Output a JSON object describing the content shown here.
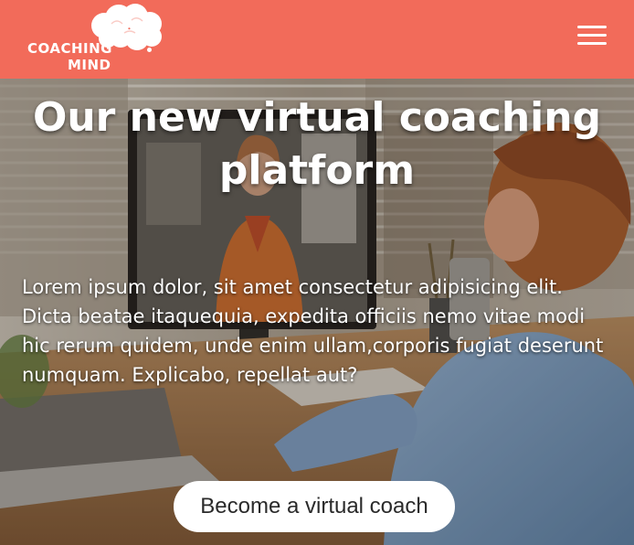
{
  "header": {
    "logo_line1": "COACHING",
    "logo_line2": "MIND",
    "background_color": "#f26b5a",
    "menu_icon": "hamburger-menu-icon"
  },
  "hero": {
    "title": "Our new virtual coaching platform",
    "body": "Lorem ipsum dolor, sit amet consectetur adipisicing elit. Dicta beatae itaquequia, expedita officiis nemo vitae modi hic rerum quidem, unde enim ullam,corporis fugiat deserunt numquam. Explicabo, repellat aut?",
    "cta_label": "Become a virtual coach"
  }
}
